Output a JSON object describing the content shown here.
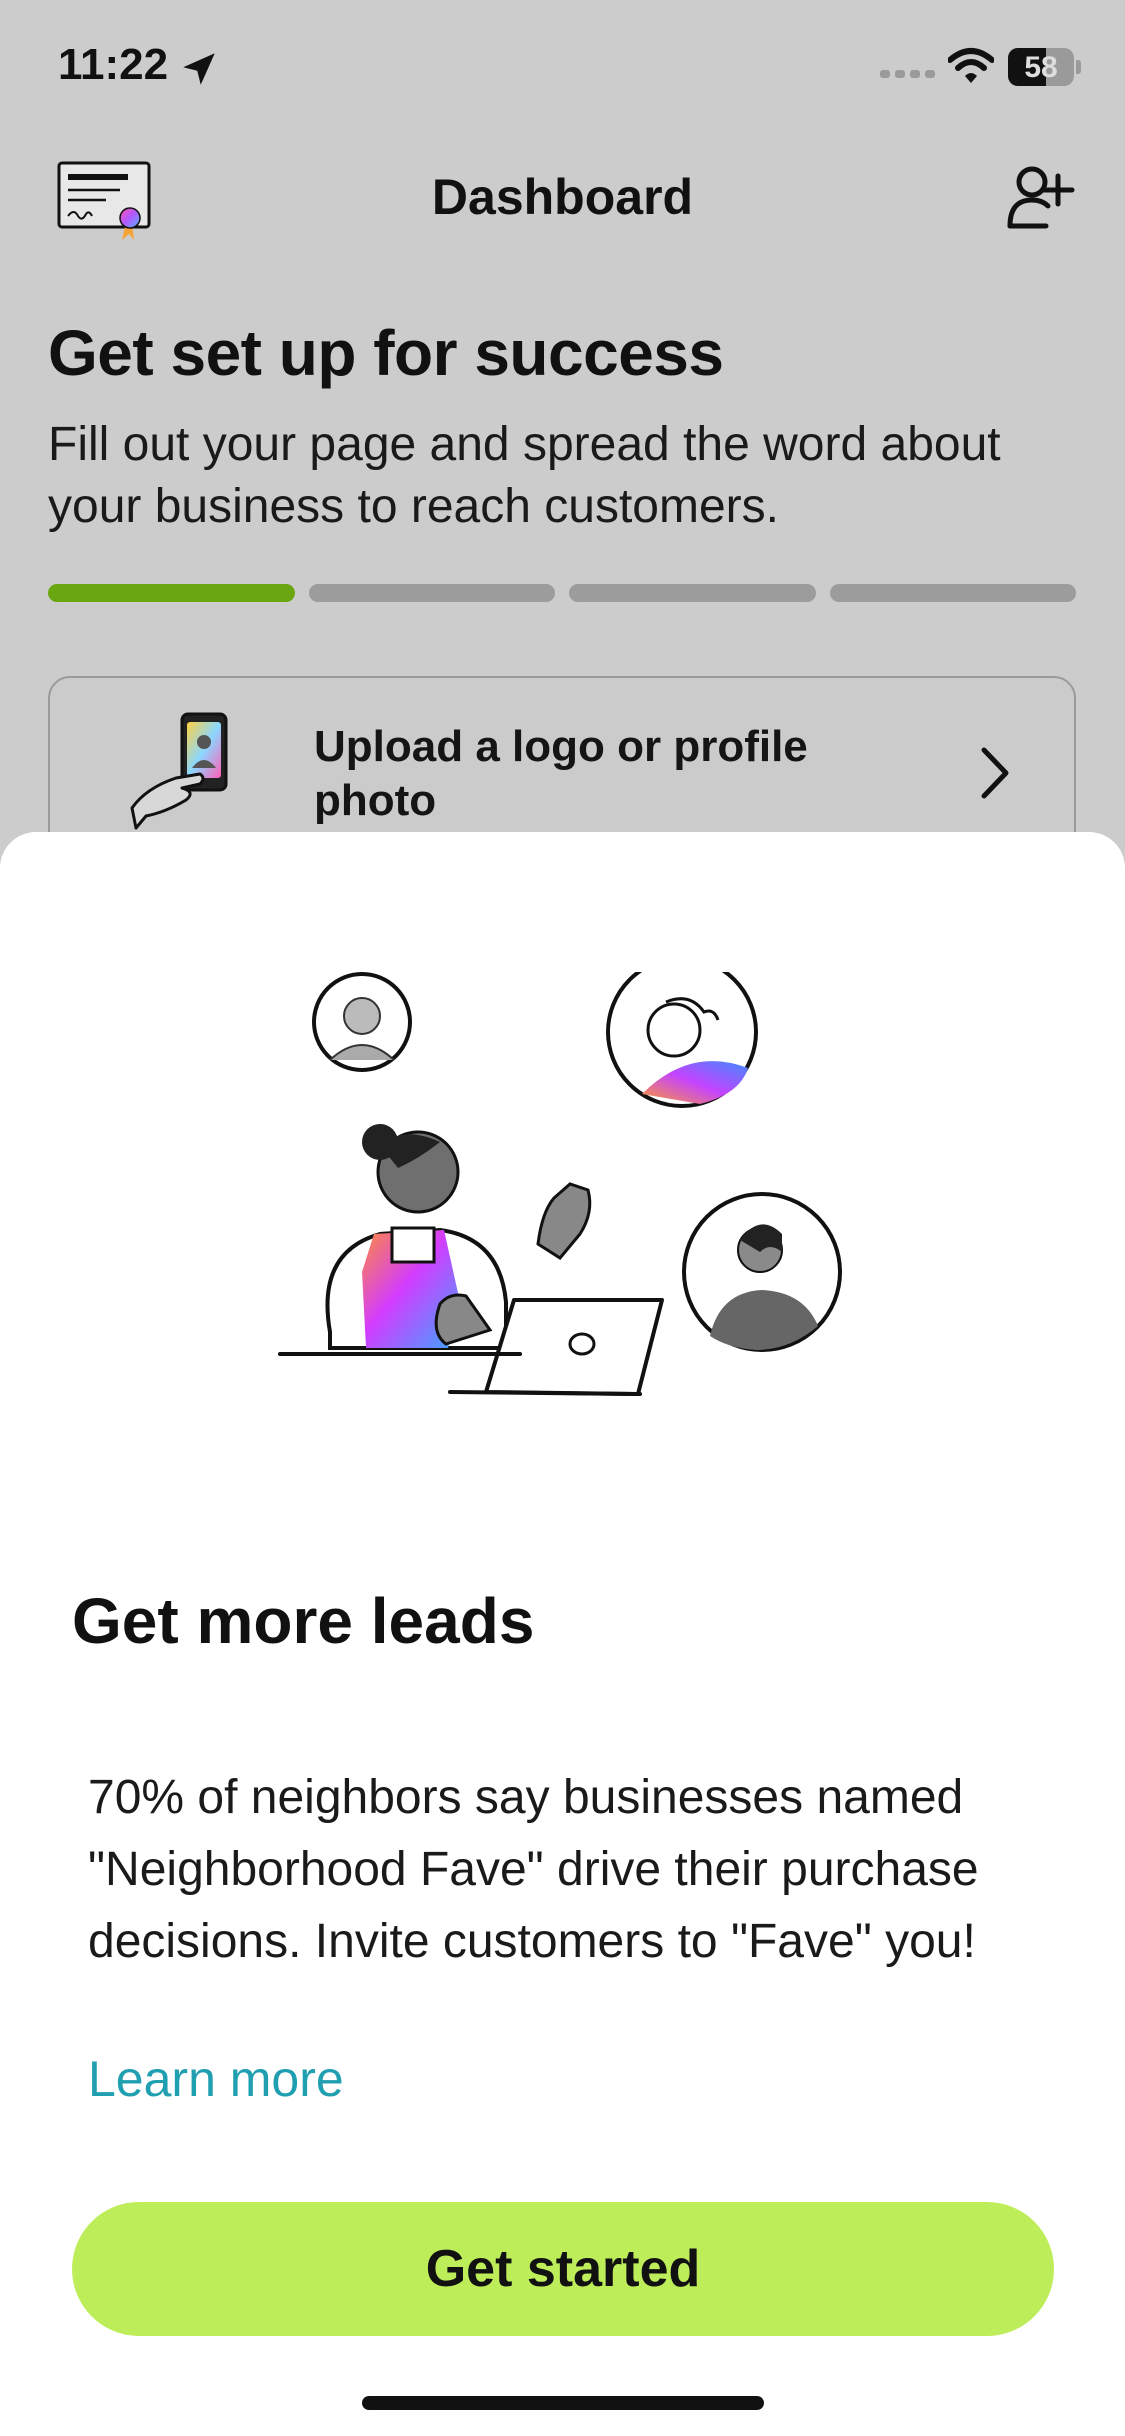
{
  "status_bar": {
    "time": "11:22",
    "battery_level": "58",
    "battery_fraction": 0.58,
    "icons": [
      "location-arrow-icon",
      "signal-icon",
      "wifi-icon",
      "battery-icon"
    ]
  },
  "header": {
    "title": "Dashboard",
    "left_icon": "certificate-icon",
    "right_icon": "add-user-icon"
  },
  "setup": {
    "title": "Get set up for success",
    "description": "Fill out your page and spread the word about your business to reach customers.",
    "progress": {
      "total_steps": 4,
      "completed_steps": 1
    },
    "task": {
      "label": "Upload a logo or profile photo",
      "icon": "hand-phone-illustration"
    }
  },
  "sheet": {
    "title": "Get more leads",
    "body": "70% of neighbors say businesses named \"Neighborhood Fave\" drive their purchase decisions. Invite customers to \"Fave\" you!",
    "learn_more": "Learn more",
    "cta_label": "Get started"
  },
  "colors": {
    "accent_green": "#6aa60f",
    "cta_green": "#bdee5a",
    "link_teal": "#1f9fb0",
    "overlay_gray": "#cccccc"
  }
}
